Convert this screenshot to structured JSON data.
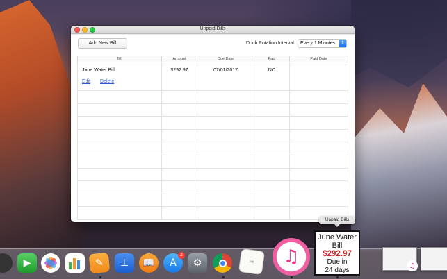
{
  "window": {
    "title": "Unpaid Bills",
    "add_button": "Add New Bill",
    "interval_label": "Dock Rotation Interval:",
    "interval_value": "Every 1 Minutes"
  },
  "table": {
    "headers": [
      "Bill",
      "Amount",
      "Due Date",
      "Paid",
      "Paid Date"
    ],
    "rows": [
      {
        "bill": "June Water Bill",
        "amount": "$292.97",
        "due_date": "07/01/2017",
        "paid": "NO",
        "paid_date": "",
        "edit": "Edit",
        "delete": "Delete"
      }
    ]
  },
  "dock": {
    "tooltip": "Unpaid Bills",
    "tile": {
      "line1": "June Water",
      "line2": "Bill",
      "amount": "$292.97",
      "line3": "Due in",
      "line4": "24 days"
    },
    "badge": "2",
    "icons": [
      "facetime-icon",
      "photos-icon",
      "numbers-icon",
      "pages-icon",
      "keynote-icon",
      "ibooks-icon",
      "appstore-icon",
      "system-preferences-icon",
      "chrome-icon",
      "textedit-icon",
      "itunes-icon"
    ]
  },
  "colors": {
    "accent": "#1c6ff2",
    "amount_red": "#e0161c",
    "link": "#2b55d9"
  }
}
